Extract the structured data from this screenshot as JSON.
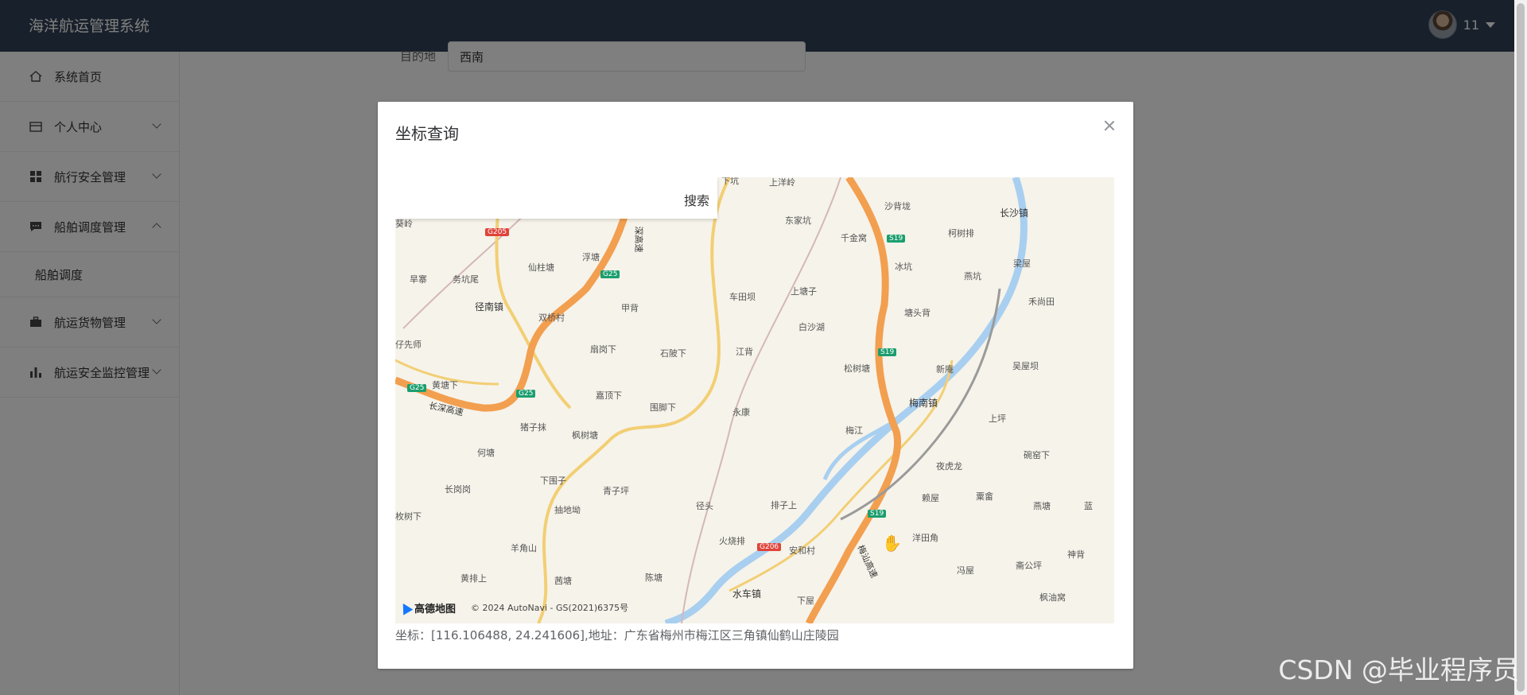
{
  "app": {
    "title": "海洋航运管理系统"
  },
  "user": {
    "name": "11"
  },
  "sidebar": {
    "items": [
      {
        "label": "系统首页",
        "icon": "home-icon"
      },
      {
        "label": "个人中心",
        "icon": "card-icon"
      },
      {
        "label": "航行安全管理",
        "icon": "grid-icon"
      },
      {
        "label": "船舶调度管理",
        "icon": "chat-icon"
      },
      {
        "label": "船舶调度",
        "icon": ""
      },
      {
        "label": "航运货物管理",
        "icon": "briefcase-icon"
      },
      {
        "label": "航运安全监控管理",
        "icon": "bar-chart-icon"
      }
    ]
  },
  "background_form": {
    "destination_label": "目的地",
    "destination_value": "西南"
  },
  "dialog": {
    "title": "坐标查询",
    "search_button": "搜索",
    "coordinate_text": "坐标：[116.106488, 24.241606],地址：广东省梅州市梅江区三角镇仙鹤山庄陵园"
  },
  "map": {
    "logo": "高德地图",
    "copyright": "© 2024 AutoNavi - GS(2021)6375号",
    "labels": [
      "上洋岭",
      "东家坑",
      "沙背垅",
      "柯树排",
      "长沙镇",
      "千金窝",
      "冰坑",
      "燕坑",
      "梁屋",
      "旱寨",
      "务坑尾",
      "浮塘",
      "径南镇",
      "双桥村",
      "甲背",
      "车田坝",
      "上塘子",
      "塘头背",
      "禾尚田",
      "白沙湖",
      "扇岗下",
      "石陂下",
      "江背",
      "新庵",
      "吴屋坝",
      "松树塘",
      "梅南镇",
      "仔先师",
      "黄塘下",
      "嘉顶下",
      "围脚下",
      "永康",
      "上坪",
      "猪子抹",
      "枫树塘",
      "梅江",
      "夜虎龙",
      "碗窑下",
      "何塘",
      "长岗岗",
      "下围子",
      "青子坪",
      "赖屋",
      "粟畲",
      "燕塘",
      "蓝",
      "枚树下",
      "抽地坳",
      "径头",
      "排子上",
      "洋田角",
      "火烧排",
      "安和村",
      "神背",
      "羊角山",
      "冯屋",
      "斋公坪",
      "黄排上",
      "茜塘",
      "陈塘",
      "水车镇",
      "下屋",
      "枫油窝",
      "仙柱塘",
      "长深高速",
      "深高速",
      "梅汕高速",
      "下坑",
      "葵岭"
    ],
    "roads": [
      "G205",
      "G25",
      "S19",
      "G206"
    ]
  },
  "watermark": "CSDN @毕业程序员",
  "colors": {
    "topbar": "#304156",
    "accent": "#409eff",
    "highway": "#f29f50",
    "river": "#a8cff0"
  }
}
